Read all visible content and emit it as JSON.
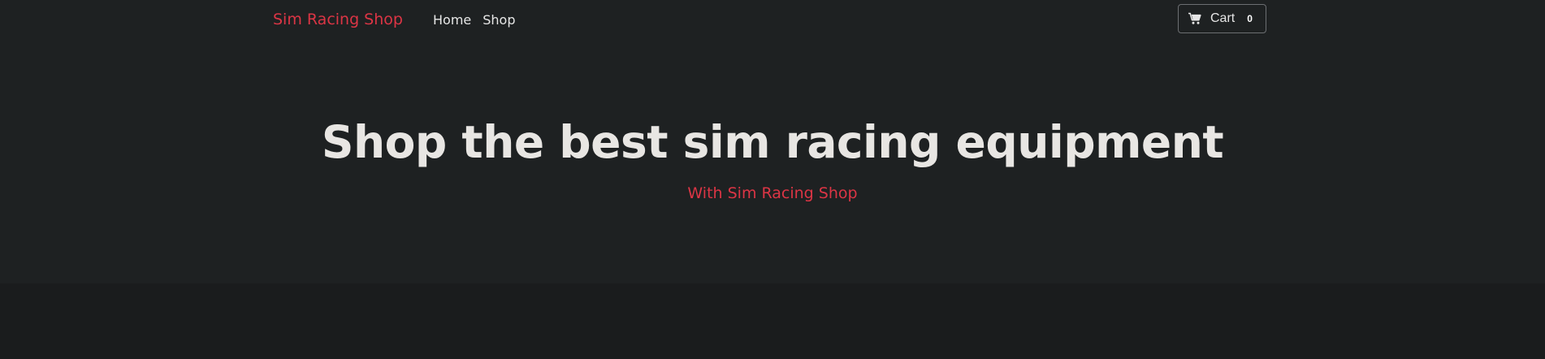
{
  "navbar": {
    "brand": "Sim Racing Shop",
    "links": [
      "Home",
      "Shop"
    ],
    "cart": {
      "icon": "cart-icon",
      "label": "Cart",
      "count": "0"
    }
  },
  "hero": {
    "title": "Shop the best sim racing equipment",
    "subtitle": "With Sim Racing Shop"
  },
  "colors": {
    "accent": "#dc3545",
    "background": "#1a1c1d",
    "surface": "#1e2122",
    "text": "#e8e6e3"
  }
}
